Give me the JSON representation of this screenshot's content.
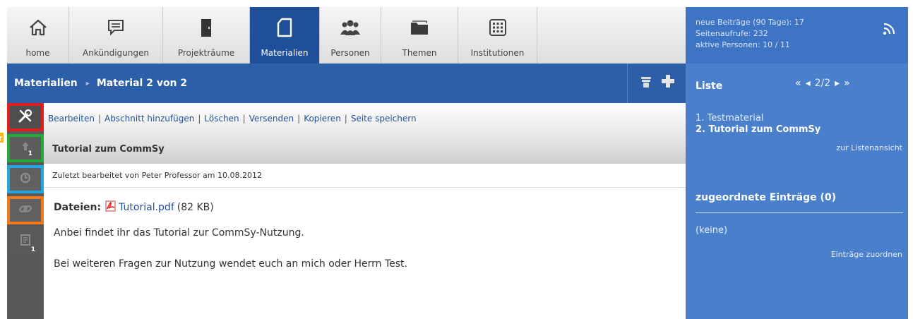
{
  "nav": {
    "tabs": [
      {
        "label": "home",
        "icon": "home-icon"
      },
      {
        "label": "Ankündigungen",
        "icon": "announcement-icon"
      },
      {
        "label": "Projekträume",
        "icon": "door-icon"
      },
      {
        "label": "Materialien",
        "icon": "document-icon",
        "active": true
      },
      {
        "label": "Personen",
        "icon": "people-icon"
      },
      {
        "label": "Themen",
        "icon": "folder-icon"
      },
      {
        "label": "Institutionen",
        "icon": "building-icon"
      }
    ]
  },
  "stats": {
    "new_posts": "neue Beiträge (90 Tage): 17",
    "page_views": "Seitenaufrufe: 232",
    "active_persons": "aktive Personen: 10 / 11"
  },
  "breadcrumb": {
    "section": "Materialien",
    "current": "Material 2 von 2"
  },
  "actions": [
    "Bearbeiten",
    "Abschnitt hinzufügen",
    "Löschen",
    "Versenden",
    "Kopieren",
    "Seite speichern"
  ],
  "left_counts": {
    "upload": "1",
    "notes": "1"
  },
  "item": {
    "title": "Tutorial zum CommSy",
    "edited": "Zuletzt bearbeitet von Peter Professor am 10.08.2012",
    "files_label": "Dateien:",
    "file_name": "Tutorial.pdf",
    "file_size": "(82 KB)",
    "paragraph1": "Anbei findet ihr das Tutorial zur CommSy-Nutzung.",
    "paragraph2": "Bei weiteren Fragen zur Nutzung wendet euch an mich oder Herrn Test."
  },
  "sidebar": {
    "liste_title": "Liste",
    "pager": {
      "first": "«",
      "prev": "◂",
      "page": "2/2",
      "next": "▸",
      "last": "»"
    },
    "items": [
      "1. Testmaterial",
      "2. Tutorial zum CommSy"
    ],
    "list_view_link": "zur Listenansicht",
    "assigned_title": "zugeordnete Einträge (0)",
    "assigned_none": "(keine)",
    "assign_link": "Einträge zuordnen"
  },
  "colors": {
    "nav_active": "#1f4f98",
    "breadcrumb_bg": "#2d5ea8",
    "sidebar_bg": "#4a7fcb",
    "highlight_red": "#e01f1f",
    "highlight_green": "#27a83a",
    "highlight_blue": "#26a6df",
    "highlight_orange": "#f07a1e"
  }
}
